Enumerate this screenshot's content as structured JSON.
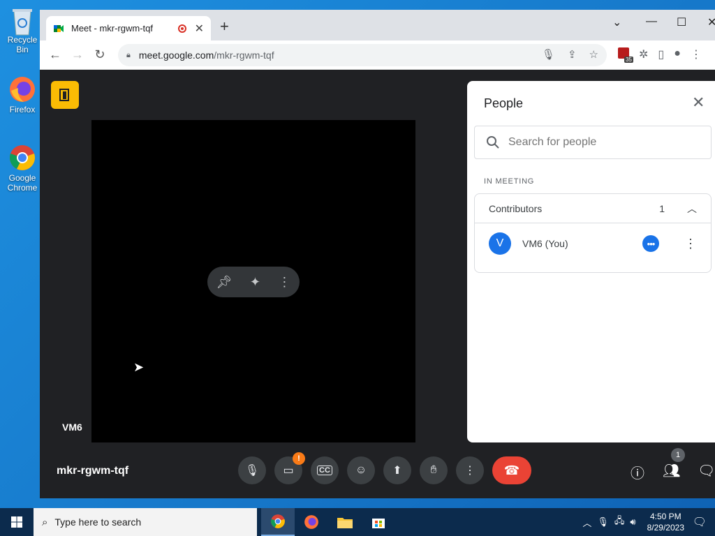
{
  "desktop": {
    "icons": [
      {
        "label": "Recycle Bin",
        "icon": "recycle-bin-icon"
      },
      {
        "label": "Firefox",
        "icon": "firefox-icon"
      },
      {
        "label": "Google Chrome",
        "icon": "chrome-icon"
      }
    ]
  },
  "browser": {
    "tab_title": "Meet - mkr-rgwm-tqf",
    "url_host": "meet.google.com",
    "url_path": "/mkr-rgwm-tqf",
    "extension_badge": "35"
  },
  "meet": {
    "tile_name": "VM6",
    "meeting_code": "mkr-rgwm-tqf",
    "camera_warning": "!",
    "people_count_badge": "1",
    "people_panel": {
      "title": "People",
      "search_placeholder": "Search for people",
      "section_label": "IN MEETING",
      "group_label": "Contributors",
      "group_count": "1",
      "members": [
        {
          "initial": "V",
          "name": "VM6 (You)"
        }
      ]
    }
  },
  "taskbar": {
    "search_placeholder": "Type here to search",
    "time": "4:50 PM",
    "date": "8/29/2023"
  },
  "colors": {
    "meet_bg": "#202124",
    "end_call": "#ea4335",
    "accent_blue": "#1a73e8",
    "meet_logo": "#fbbc04"
  }
}
